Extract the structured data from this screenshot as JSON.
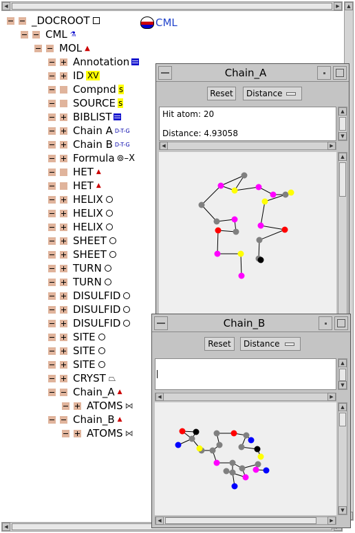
{
  "tree": {
    "root": "_DOCROOT",
    "cml": "CML",
    "cml_logo_text": "CML",
    "mol": "MOL",
    "items": [
      {
        "label": "Annotation",
        "icon": "list-icon"
      },
      {
        "label": "ID",
        "icon": "xv-icon",
        "badge": "XV"
      },
      {
        "label": "Compnd",
        "icon": "s-icon",
        "badge": "s"
      },
      {
        "label": "SOURCE",
        "icon": "s-icon",
        "badge": "s"
      },
      {
        "label": "BIBLIST",
        "icon": "list-icon"
      },
      {
        "label": "Chain A",
        "icon": "dtg-icon",
        "badge": "D-T-G"
      },
      {
        "label": "Chain B",
        "icon": "dtg-icon",
        "badge": "D-T-G"
      },
      {
        "label": "Formula",
        "icon": "formula-icon",
        "badge": "X"
      },
      {
        "label": "HET",
        "icon": "atom-icon"
      },
      {
        "label": "HET",
        "icon": "atom-icon"
      },
      {
        "label": "HELIX",
        "icon": "circle-icon"
      },
      {
        "label": "HELIX",
        "icon": "circle-icon"
      },
      {
        "label": "HELIX",
        "icon": "circle-icon"
      },
      {
        "label": "SHEET",
        "icon": "circle-icon"
      },
      {
        "label": "SHEET",
        "icon": "circle-icon"
      },
      {
        "label": "TURN",
        "icon": "circle-icon"
      },
      {
        "label": "TURN",
        "icon": "circle-icon"
      },
      {
        "label": "DISULFID",
        "icon": "circle-icon"
      },
      {
        "label": "DISULFID",
        "icon": "circle-icon"
      },
      {
        "label": "DISULFID",
        "icon": "circle-icon"
      },
      {
        "label": "SITE",
        "icon": "circle-icon"
      },
      {
        "label": "SITE",
        "icon": "circle-icon"
      },
      {
        "label": "SITE",
        "icon": "circle-icon"
      },
      {
        "label": "CRYST",
        "icon": "crystal-icon"
      },
      {
        "label": "Chain_A",
        "icon": "atom-icon"
      },
      {
        "label": "ATOMS",
        "icon": "atoms-icon"
      },
      {
        "label": "Chain_B",
        "icon": "atom-icon"
      },
      {
        "label": "ATOMS",
        "icon": "atoms-icon"
      }
    ]
  },
  "chain_a": {
    "title": "Chain_A",
    "reset": "Reset",
    "mode": "Distance",
    "hit_atom": "Hit atom: 20",
    "distance": "Distance: 4.93058"
  },
  "chain_b": {
    "title": "Chain_B",
    "reset": "Reset",
    "mode": "Distance",
    "text": ""
  },
  "colors": {
    "magenta": "#ff00ff",
    "yellow": "#ffff00",
    "gray": "#808080",
    "red": "#ff0000",
    "black": "#000000",
    "blue": "#0000ff",
    "expander": "#e0b49c"
  }
}
